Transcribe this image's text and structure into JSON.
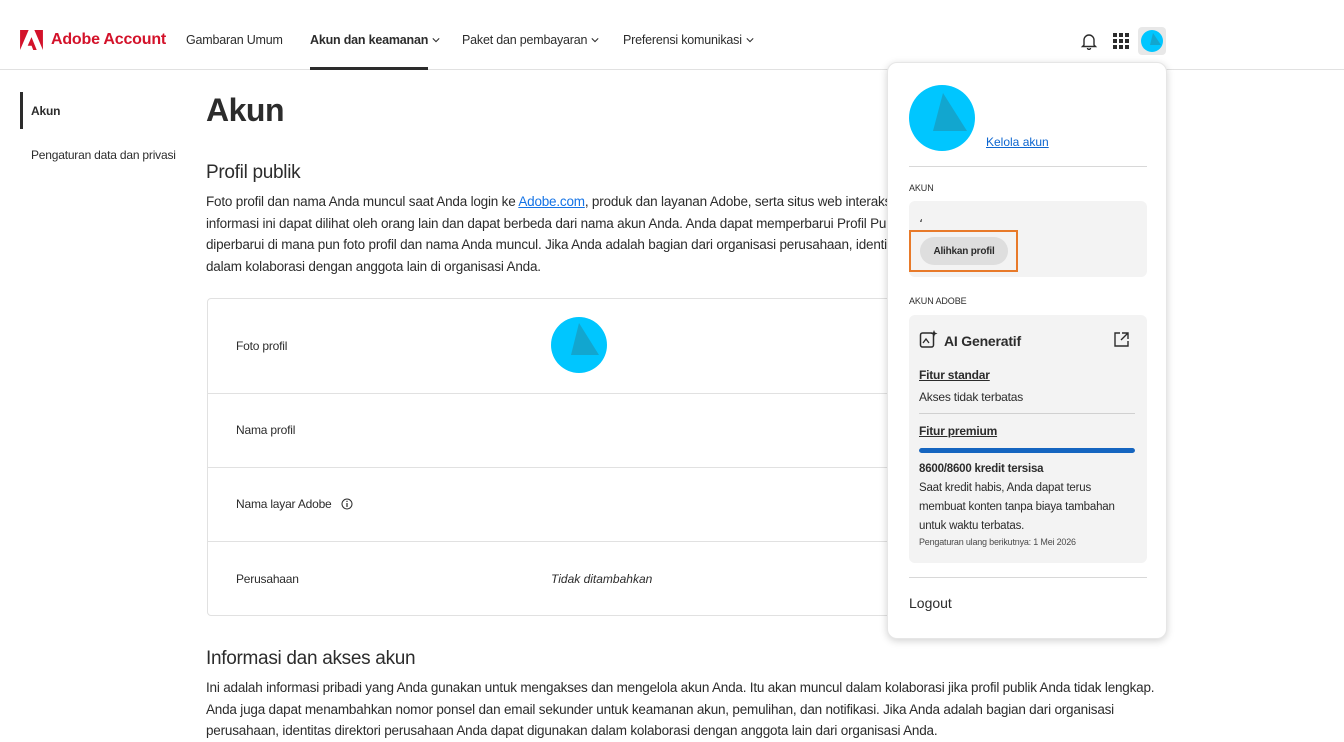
{
  "header": {
    "brand": "Adobe Account",
    "nav": [
      {
        "label": "Gambaran Umum"
      },
      {
        "label": "Akun dan keamanan"
      },
      {
        "label": "Paket dan pembayaran"
      },
      {
        "label": "Preferensi komunikasi"
      }
    ]
  },
  "sidebar": {
    "items": [
      {
        "label": "Akun"
      },
      {
        "label": "Pengaturan data dan privasi"
      }
    ]
  },
  "main": {
    "title": "Akun",
    "public_profile": {
      "heading": "Profil publik",
      "para_line1_pre": "Foto profil dan nama Anda muncul saat Anda login ke ",
      "para_link": "Adobe.com",
      "para_line1_post": ", produk dan layanan Adobe, serta situs web interaksi p",
      "para_line2": "informasi ini dapat dilihat oleh orang lain dan dapat berbeda dari nama akun Anda. Anda dapat memperbarui Profil Publi",
      "para_line3": "diperbarui di mana pun foto profil dan nama Anda muncul. Jika Anda adalah bagian dari organisasi perusahaan, identitas",
      "para_line4": "dalam kolaborasi dengan anggota lain di organisasi Anda."
    },
    "profile_rows": {
      "photo": "Foto profil",
      "name": "Nama profil",
      "screen_name": "Nama layar Adobe",
      "company": "Perusahaan",
      "company_value": "Tidak ditambahkan"
    },
    "account_info": {
      "heading": "Informasi dan akses akun",
      "line1": "Ini adalah informasi pribadi yang Anda gunakan untuk mengakses dan mengelola akun Anda. Itu akan muncul dalam kolaborasi jika profil publik Anda tidak lengkap.",
      "line2": "Anda juga dapat menambahkan nomor ponsel dan email sekunder untuk keamanan akun, pemulihan, dan notifikasi. Jika Anda adalah bagian dari organisasi",
      "line3": "perusahaan, identitas direktori perusahaan Anda dapat digunakan dalam kolaborasi dengan anggota lain dari organisasi Anda."
    }
  },
  "popover": {
    "manage_link": "Kelola akun",
    "account_caption": "AKUN",
    "account_name": "،",
    "switch_profile": "Alihkan profil",
    "adobe_account_caption": "AKUN ADOBE",
    "gen_ai": {
      "title": "AI Generatif",
      "standard_label": "Fitur standar",
      "standard_desc": "Akses tidak terbatas",
      "premium_label": "Fitur premium",
      "credits_fraction": 1.0,
      "credits_text": "8600/8600 kredit tersisa",
      "credits_desc": "Saat kredit habis, Anda dapat terus membuat konten tanpa biaya tambahan untuk waktu terbatas.",
      "reset_note": "Pengaturan ulang berikutnya: 1 Mei 2026"
    },
    "logout": "Logout"
  },
  "colors": {
    "brand_red": "#d3122a",
    "avatar_cyan": "#00c6ff",
    "highlight_orange": "#e87a2a",
    "progress_blue": "#1565c0",
    "link_blue": "#1473e6"
  },
  "icons": [
    "adobe-logo-icon",
    "chevron-down-icon",
    "bell-icon",
    "apps-grid-icon",
    "info-icon",
    "generative-ai-icon",
    "external-link-icon"
  ]
}
